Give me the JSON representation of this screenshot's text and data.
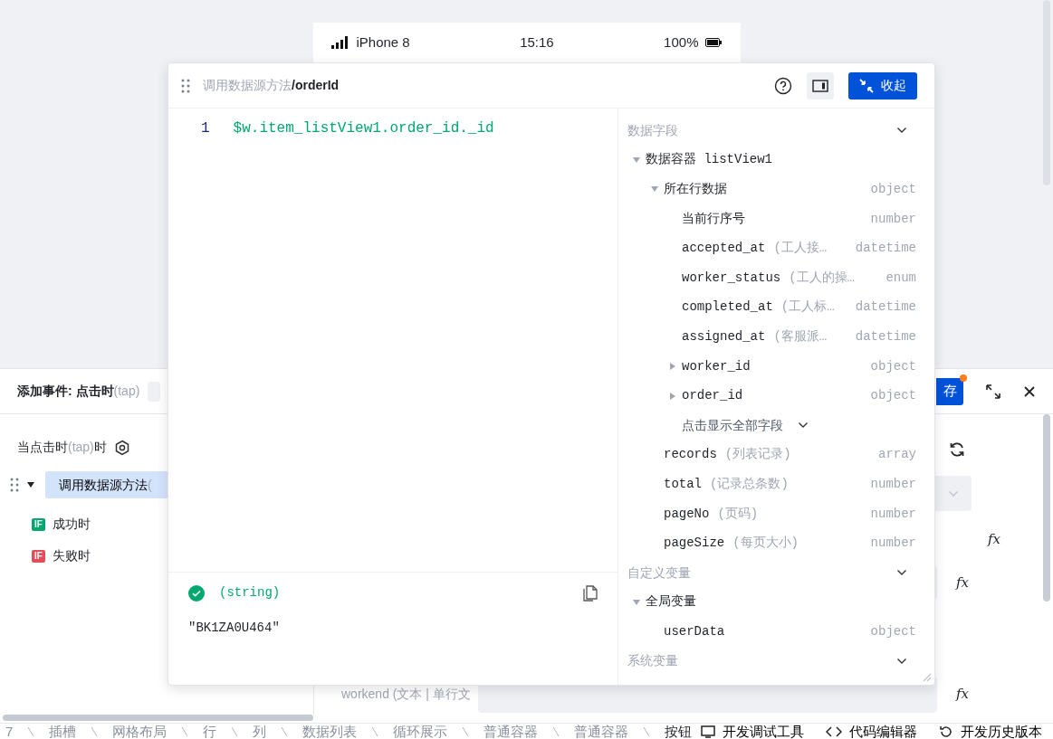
{
  "phone_status": {
    "carrier": "iPhone 8",
    "time": "15:16",
    "battery": "100%"
  },
  "event_panel": {
    "title": "添加事件: 点击时",
    "title_hint": "(tap)",
    "save_button": "存",
    "trigger": {
      "before": "当点击时",
      "hint": "(tap)",
      "after": "时"
    },
    "actions": [
      {
        "label": "调用数据源方法",
        "hint": "(",
        "expanded": true,
        "selected": true
      }
    ],
    "branches": [
      {
        "badge": "IF",
        "label": "成功时",
        "color": "#00a870"
      },
      {
        "badge": "IF",
        "label": "失败时",
        "color": "#e34d59"
      }
    ],
    "fields": [
      {
        "kind": "refresh"
      },
      {
        "kind": "select"
      },
      {
        "kind": "formula",
        "icon": "fx"
      },
      {
        "kind": "input_formula",
        "icon": "fx"
      },
      {
        "kind": "labeled_input_formula",
        "label": "workend (文本 | 单行文",
        "icon": "fx"
      }
    ]
  },
  "expression_popup": {
    "path_parent": "调用数据源方法",
    "path_current": "/orderId",
    "collapse_button": "收起",
    "code_lines": [
      {
        "number": "1",
        "code": "$w.item_listView1.order_id._id"
      }
    ],
    "result": {
      "valid": true,
      "type": "(string)",
      "value": "\"BK1ZA0U464\""
    },
    "sections": [
      {
        "title": "数据字段",
        "nodes": [
          {
            "name": "数据容器 listView1",
            "expanded": true,
            "children": [
              {
                "name": "所在行数据",
                "type": "object",
                "expanded": true,
                "children": [
                  {
                    "name": "当前行序号",
                    "type": "number"
                  },
                  {
                    "name": "accepted_at",
                    "desc": "(工人接…",
                    "type": "datetime"
                  },
                  {
                    "name": "worker_status",
                    "desc": "(工人的操…",
                    "type": "enum"
                  },
                  {
                    "name": "completed_at",
                    "desc": "(工人标…",
                    "type": "datetime"
                  },
                  {
                    "name": "assigned_at",
                    "desc": "(客服派…",
                    "type": "datetime"
                  },
                  {
                    "name": "worker_id",
                    "type": "object",
                    "expanded": false
                  },
                  {
                    "name": "order_id",
                    "type": "object",
                    "expanded": false
                  },
                  {
                    "kind": "more",
                    "name": "点击显示全部字段"
                  }
                ]
              },
              {
                "name": "records",
                "desc": "(列表记录)",
                "type": "array"
              },
              {
                "name": "total",
                "desc": "(记录总条数)",
                "type": "number"
              },
              {
                "name": "pageNo",
                "desc": "(页码)",
                "type": "number"
              },
              {
                "name": "pageSize",
                "desc": "(每页大小)",
                "type": "number"
              }
            ]
          }
        ]
      },
      {
        "title": "自定义变量",
        "nodes": [
          {
            "name": "全局变量",
            "expanded": true,
            "children": [
              {
                "name": "userData",
                "type": "object"
              }
            ]
          }
        ]
      },
      {
        "title": "系统变量"
      }
    ]
  },
  "breadcrumb": [
    {
      "label": "7",
      "selected": false
    },
    {
      "label": "插槽",
      "selected": false
    },
    {
      "label": "网格布局",
      "selected": false
    },
    {
      "label": "行",
      "selected": false
    },
    {
      "label": "列",
      "selected": false
    },
    {
      "label": "数据列表",
      "selected": false
    },
    {
      "label": "循环展示",
      "selected": false
    },
    {
      "label": "普通容器",
      "selected": false
    },
    {
      "label": "普通容器",
      "selected": false
    },
    {
      "label": "按钮",
      "selected": true
    }
  ],
  "footer_tools": [
    {
      "kind": "debug",
      "label": "开发调试工具"
    },
    {
      "kind": "code",
      "label": "代码编辑器"
    },
    {
      "kind": "history",
      "label": "开发历史版本"
    }
  ]
}
